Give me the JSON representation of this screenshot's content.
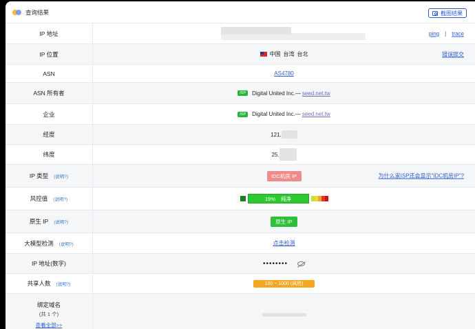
{
  "header": {
    "title": "查询结果",
    "screenshot_label": "截图结果"
  },
  "hint_label": "(说明?)",
  "rows": {
    "ip_addr": {
      "label": "IP 地址",
      "link1": "ping",
      "sep": "|",
      "link2": "trace"
    },
    "ip_loc": {
      "label": "IP 位置",
      "country": "中国",
      "region": "台湾",
      "city": "台北",
      "action": "错误提交"
    },
    "asn": {
      "label": "ASN",
      "value": "AS4780"
    },
    "asn_owner": {
      "label": "ASN 所有者",
      "badge": "ISP",
      "org": "Digital United Inc.—",
      "domain": "seed.net.tw"
    },
    "company": {
      "label": "企业",
      "badge": "ISP",
      "org": "Digital United Inc.—",
      "domain": "seed.net.tw"
    },
    "lng": {
      "label": "经度",
      "value": "121."
    },
    "lat": {
      "label": "纬度",
      "value": "25."
    },
    "ip_type": {
      "label": "IP 类型",
      "value": "IDC机房 IP",
      "question": "为什么家ISP还会显示\"IDC机房IP\"?"
    },
    "risk": {
      "label": "风控值",
      "percent": "19%",
      "level": "纯净",
      "score": 19
    },
    "native": {
      "label": "原生 IP",
      "value": "原生 IP"
    },
    "llm": {
      "label": "大模型检测",
      "action": "点击检测"
    },
    "ip_num": {
      "label": "IP 地址(数字)",
      "masked": "••••••••"
    },
    "share": {
      "label": "共享人数",
      "value": "100 ~ 1000 (风险)"
    },
    "domains": {
      "label": "绑定域名",
      "count": "(共 1 个)",
      "view_all": "查看全部>>"
    }
  },
  "colors": {
    "accent": "#2f5bd1",
    "risk_green": "#2ec930",
    "idc": "#f08b8b",
    "share": "#f5a623"
  }
}
